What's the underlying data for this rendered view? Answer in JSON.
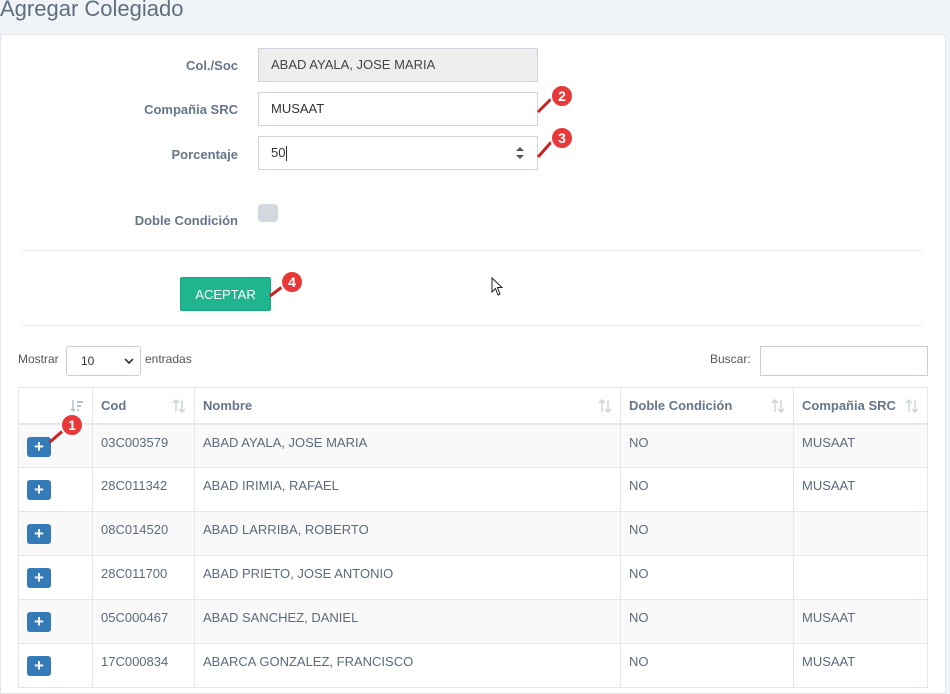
{
  "page": {
    "title": "Agregar Colegiado"
  },
  "form": {
    "col_soc": {
      "label": "Col./Soc",
      "value": "ABAD AYALA, JOSE MARIA"
    },
    "compania": {
      "label": "Compañia SRC",
      "value": "MUSAAT"
    },
    "porcentaje": {
      "label": "Porcentaje",
      "value": "50"
    },
    "doble_condicion": {
      "label": "Doble Condición",
      "checked": false
    },
    "accept_label": "ACEPTAR"
  },
  "markers": [
    "1",
    "2",
    "3",
    "4"
  ],
  "table_controls": {
    "show_label": "Mostrar",
    "entries_value": "10",
    "entries_label": "entradas",
    "search_label": "Buscar:",
    "search_value": ""
  },
  "table": {
    "headers": [
      "",
      "Cod",
      "Nombre",
      "Doble Condición",
      "Compañia SRC"
    ],
    "rows": [
      {
        "cod": "03C003579",
        "nombre": "ABAD AYALA, JOSE MARIA",
        "doble": "NO",
        "compania": "MUSAAT"
      },
      {
        "cod": "28C011342",
        "nombre": "ABAD IRIMIA, RAFAEL",
        "doble": "NO",
        "compania": "MUSAAT"
      },
      {
        "cod": "08C014520",
        "nombre": "ABAD LARRIBA, ROBERTO",
        "doble": "NO",
        "compania": ""
      },
      {
        "cod": "28C011700",
        "nombre": "ABAD PRIETO, JOSE ANTONIO",
        "doble": "NO",
        "compania": ""
      },
      {
        "cod": "05C000467",
        "nombre": "ABAD SANCHEZ, DANIEL",
        "doble": "NO",
        "compania": "MUSAAT"
      },
      {
        "cod": "17C000834",
        "nombre": "ABARCA GONZALEZ, FRANCISCO",
        "doble": "NO",
        "compania": "MUSAAT"
      }
    ],
    "add_icon": "plus-icon"
  },
  "colors": {
    "accent_green": "#1fb58f",
    "primary_blue": "#337ab7",
    "marker_red": "#e8393a"
  }
}
